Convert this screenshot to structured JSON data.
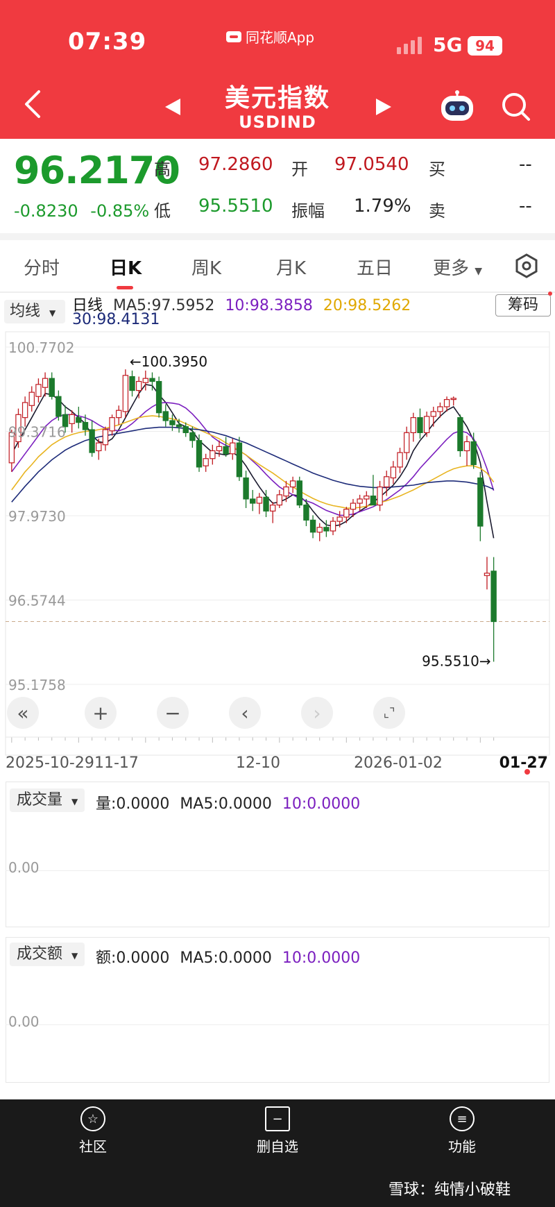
{
  "status": {
    "time": "07:39",
    "app_label": "同花顺App",
    "network": "5G",
    "battery": "94"
  },
  "header": {
    "title": "美元指数",
    "code": "USDIND"
  },
  "quote": {
    "price": "96.2170",
    "change": "-0.8230",
    "change_pct": "-0.85%",
    "high_label": "高",
    "high": "97.2860",
    "open_label": "开",
    "open": "97.0540",
    "buy_label": "买",
    "buy": "--",
    "low_label": "低",
    "low": "95.5510",
    "amp_label": "振幅",
    "amplitude": "1.79%",
    "sell_label": "卖",
    "sell": "--"
  },
  "tabs": [
    "分时",
    "日K",
    "周K",
    "月K",
    "五日",
    "更多"
  ],
  "ma_bar": {
    "selector": "均线",
    "prefix": "日线",
    "ma5": "MA5:97.5952",
    "ma10": "10:98.3858",
    "ma20": "20:98.5262",
    "ma30": "30:98.4131",
    "chip_button": "筹码"
  },
  "chart_data": {
    "type": "candlestick",
    "y_ticks": [
      "100.7702",
      "99.3716",
      "97.9730",
      "96.5744",
      "95.1758"
    ],
    "ylim": [
      95.1758,
      100.7702
    ],
    "x_labels": [
      "2025-10-29",
      "11-17",
      "12-10",
      "2026-01-02",
      "01-27"
    ],
    "max_annotation": "←100.3950",
    "min_annotation": "95.5510→",
    "last_price": 96.217,
    "candles": [
      [
        98.85,
        99.4,
        98.7,
        99.35
      ],
      [
        99.2,
        99.75,
        99.1,
        99.65
      ],
      [
        99.6,
        99.95,
        99.45,
        99.85
      ],
      [
        99.8,
        100.12,
        99.7,
        100.02
      ],
      [
        99.95,
        100.25,
        99.85,
        100.15
      ],
      [
        100.1,
        100.35,
        99.95,
        100.25
      ],
      [
        100.25,
        100.35,
        99.9,
        99.95
      ],
      [
        99.95,
        100.05,
        99.55,
        99.62
      ],
      [
        99.65,
        99.8,
        99.35,
        99.45
      ],
      [
        99.5,
        99.72,
        99.35,
        99.65
      ],
      [
        99.6,
        99.78,
        99.42,
        99.52
      ],
      [
        99.52,
        99.65,
        99.3,
        99.4
      ],
      [
        99.4,
        99.55,
        98.95,
        99.02
      ],
      [
        99.05,
        99.25,
        98.9,
        99.18
      ],
      [
        99.15,
        99.45,
        99.05,
        99.4
      ],
      [
        99.38,
        99.65,
        99.3,
        99.6
      ],
      [
        99.6,
        99.8,
        99.48,
        99.72
      ],
      [
        99.7,
        100.4,
        99.6,
        100.3
      ],
      [
        100.28,
        100.38,
        99.95,
        100.05
      ],
      [
        100.05,
        100.28,
        99.92,
        100.2
      ],
      [
        100.18,
        100.38,
        100.05,
        100.25
      ],
      [
        100.25,
        100.35,
        100.05,
        100.2
      ],
      [
        100.2,
        100.28,
        99.6,
        99.68
      ],
      [
        99.7,
        99.82,
        99.45,
        99.55
      ],
      [
        99.55,
        99.65,
        99.38,
        99.48
      ],
      [
        99.48,
        99.58,
        99.35,
        99.45
      ],
      [
        99.45,
        99.52,
        99.28,
        99.35
      ],
      [
        99.35,
        99.45,
        99.1,
        99.22
      ],
      [
        99.22,
        99.32,
        98.7,
        98.78
      ],
      [
        98.8,
        99.0,
        98.7,
        98.92
      ],
      [
        98.92,
        99.15,
        98.82,
        99.05
      ],
      [
        99.05,
        99.22,
        98.95,
        99.12
      ],
      [
        99.12,
        99.28,
        98.95,
        99.0
      ],
      [
        99.0,
        99.25,
        98.9,
        99.18
      ],
      [
        99.18,
        99.28,
        98.55,
        98.62
      ],
      [
        98.6,
        98.72,
        98.1,
        98.25
      ],
      [
        98.25,
        98.4,
        98.05,
        98.18
      ],
      [
        98.18,
        98.35,
        98.0,
        98.28
      ],
      [
        98.28,
        98.4,
        97.95,
        98.05
      ],
      [
        98.05,
        98.2,
        97.85,
        98.15
      ],
      [
        98.15,
        98.4,
        98.1,
        98.32
      ],
      [
        98.3,
        98.55,
        98.2,
        98.45
      ],
      [
        98.45,
        98.62,
        98.35,
        98.55
      ],
      [
        98.55,
        98.62,
        98.1,
        98.15
      ],
      [
        98.15,
        98.25,
        97.8,
        97.9
      ],
      [
        97.9,
        97.98,
        97.6,
        97.7
      ],
      [
        97.7,
        97.85,
        97.55,
        97.78
      ],
      [
        97.78,
        97.9,
        97.62,
        97.72
      ],
      [
        97.72,
        97.95,
        97.65,
        97.88
      ],
      [
        97.88,
        98.05,
        97.78,
        97.95
      ],
      [
        97.95,
        98.12,
        97.85,
        98.08
      ],
      [
        98.08,
        98.25,
        97.95,
        98.18
      ],
      [
        98.18,
        98.32,
        98.05,
        98.25
      ],
      [
        98.25,
        98.38,
        98.1,
        98.3
      ],
      [
        98.3,
        98.65,
        98.2,
        98.15
      ],
      [
        98.15,
        98.55,
        98.05,
        98.45
      ],
      [
        98.45,
        98.72,
        98.3,
        98.62
      ],
      [
        98.6,
        98.88,
        98.5,
        98.78
      ],
      [
        98.78,
        99.1,
        98.68,
        99.02
      ],
      [
        99.02,
        99.45,
        98.9,
        99.35
      ],
      [
        99.35,
        99.68,
        99.2,
        99.6
      ],
      [
        99.6,
        99.75,
        99.25,
        99.35
      ],
      [
        99.35,
        99.7,
        99.28,
        99.62
      ],
      [
        99.62,
        99.78,
        99.45,
        99.7
      ],
      [
        99.7,
        99.85,
        99.6,
        99.78
      ],
      [
        99.78,
        99.95,
        99.7,
        99.9
      ],
      [
        99.9,
        99.95,
        99.8,
        99.92
      ],
      [
        99.6,
        99.65,
        98.95,
        99.05
      ],
      [
        99.05,
        99.3,
        98.8,
        99.2
      ],
      [
        99.2,
        99.35,
        98.75,
        98.82
      ],
      [
        98.6,
        98.7,
        97.55,
        97.8
      ],
      [
        96.98,
        97.29,
        96.75,
        97.02
      ],
      [
        97.054,
        97.286,
        95.551,
        96.217
      ]
    ],
    "ma_series": [
      {
        "name": "MA5",
        "color": "#1a1a2e",
        "values": [
          99.0,
          99.2,
          99.4,
          99.6,
          99.8,
          100.0,
          99.98,
          99.9,
          99.78,
          99.7,
          99.6,
          99.5,
          99.3,
          99.2,
          99.18,
          99.25,
          99.4,
          99.6,
          99.8,
          100.0,
          100.15,
          100.13,
          99.98,
          99.85,
          99.68,
          99.5,
          99.45,
          99.38,
          99.22,
          99.12,
          99.02,
          99.0,
          98.98,
          99.02,
          98.95,
          98.8,
          98.62,
          98.45,
          98.3,
          98.18,
          98.2,
          98.25,
          98.32,
          98.3,
          98.2,
          98.05,
          97.92,
          97.82,
          97.8,
          97.82,
          97.88,
          97.98,
          98.05,
          98.12,
          98.2,
          98.28,
          98.38,
          98.48,
          98.62,
          98.8,
          99.05,
          99.22,
          99.35,
          99.5,
          99.62,
          99.72,
          99.78,
          99.62,
          99.45,
          99.22,
          98.85,
          98.2,
          97.6
        ]
      },
      {
        "name": "MA10",
        "color": "#7b1fbf",
        "values": [
          98.7,
          98.85,
          99.0,
          99.15,
          99.3,
          99.45,
          99.55,
          99.62,
          99.65,
          99.65,
          99.63,
          99.6,
          99.55,
          99.48,
          99.42,
          99.4,
          99.38,
          99.42,
          99.5,
          99.6,
          99.7,
          99.78,
          99.84,
          99.85,
          99.84,
          99.82,
          99.76,
          99.66,
          99.54,
          99.4,
          99.28,
          99.2,
          99.14,
          99.1,
          99.05,
          98.98,
          98.88,
          98.78,
          98.66,
          98.55,
          98.45,
          98.38,
          98.32,
          98.26,
          98.22,
          98.18,
          98.12,
          98.06,
          98.02,
          97.98,
          97.98,
          98.0,
          98.04,
          98.08,
          98.12,
          98.18,
          98.24,
          98.32,
          98.4,
          98.5,
          98.62,
          98.76,
          98.88,
          99.0,
          99.12,
          99.24,
          99.34,
          99.38,
          99.35,
          99.25,
          99.05,
          98.75,
          98.39
        ]
      },
      {
        "name": "MA20",
        "color": "#e8b420",
        "values": [
          98.4,
          98.55,
          98.7,
          98.82,
          98.95,
          99.05,
          99.15,
          99.22,
          99.28,
          99.32,
          99.35,
          99.37,
          99.38,
          99.4,
          99.42,
          99.45,
          99.48,
          99.52,
          99.56,
          99.6,
          99.62,
          99.63,
          99.62,
          99.6,
          99.58,
          99.55,
          99.5,
          99.45,
          99.4,
          99.35,
          99.3,
          99.25,
          99.18,
          99.12,
          99.05,
          98.98,
          98.9,
          98.82,
          98.75,
          98.68,
          98.6,
          98.52,
          98.45,
          98.38,
          98.32,
          98.26,
          98.21,
          98.17,
          98.14,
          98.12,
          98.1,
          98.1,
          98.11,
          98.13,
          98.16,
          98.19,
          98.22,
          98.26,
          98.3,
          98.35,
          98.4,
          98.46,
          98.52,
          98.58,
          98.64,
          98.7,
          98.75,
          98.78,
          98.8,
          98.8,
          98.76,
          98.68,
          98.53
        ]
      },
      {
        "name": "MA30",
        "color": "#1c2a78",
        "values": [
          98.2,
          98.33,
          98.46,
          98.58,
          98.7,
          98.8,
          98.9,
          98.98,
          99.06,
          99.12,
          99.17,
          99.22,
          99.25,
          99.28,
          99.3,
          99.32,
          99.34,
          99.36,
          99.38,
          99.4,
          99.42,
          99.43,
          99.44,
          99.44,
          99.44,
          99.43,
          99.42,
          99.41,
          99.4,
          99.38,
          99.36,
          99.33,
          99.3,
          99.26,
          99.22,
          99.18,
          99.13,
          99.08,
          99.03,
          98.98,
          98.93,
          98.88,
          98.83,
          98.78,
          98.73,
          98.68,
          98.64,
          98.6,
          98.56,
          98.53,
          98.5,
          98.48,
          98.46,
          98.45,
          98.44,
          98.44,
          98.44,
          98.45,
          98.46,
          98.47,
          98.48,
          98.5,
          98.52,
          98.53,
          98.54,
          98.55,
          98.55,
          98.54,
          98.53,
          98.51,
          98.49,
          98.46,
          98.41
        ]
      }
    ]
  },
  "volume_panel": {
    "selector": "成交量",
    "text": "量:0.0000",
    "ma5": "MA5:0.0000",
    "ma10": "10:0.0000",
    "zero": "0.00"
  },
  "amount_panel": {
    "selector": "成交额",
    "text": "额:0.0000",
    "ma5": "MA5:0.0000",
    "ma10": "10:0.0000",
    "zero": "0.00"
  },
  "bottom_nav": [
    {
      "label": "社区",
      "icon": "community-icon"
    },
    {
      "label": "删自选",
      "icon": "remove-watchlist-icon"
    },
    {
      "label": "功能",
      "icon": "menu-icon"
    }
  ],
  "watermark": "雪球：纯情小破鞋",
  "colors": {
    "header": "#f03a40",
    "up": "#c0181f",
    "down": "#1c7a2c",
    "ma5": "#1a1a2e",
    "ma10": "#7b1fbf",
    "ma20": "#e8b420",
    "ma30": "#1c2a78"
  }
}
